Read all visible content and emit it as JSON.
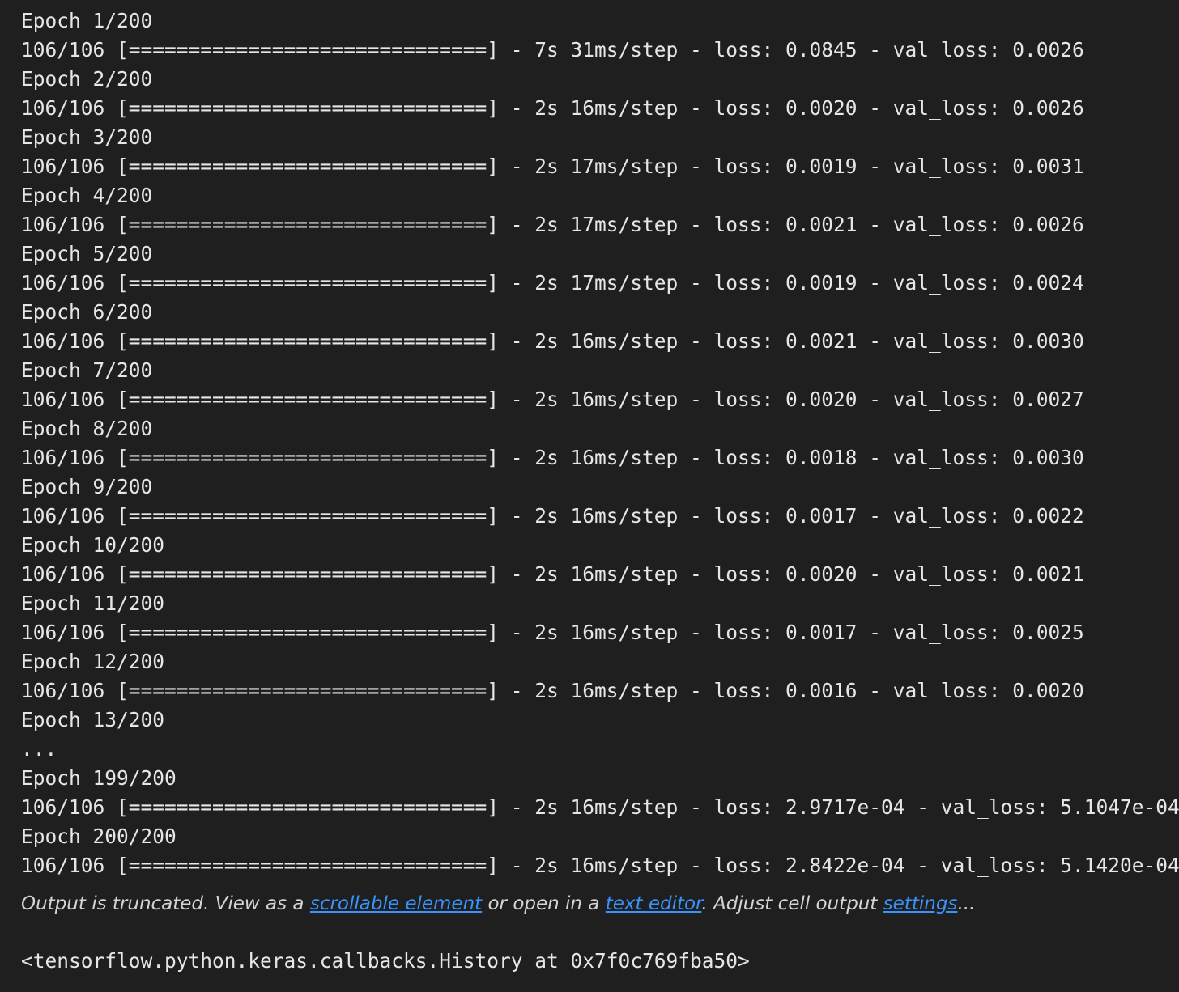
{
  "output": {
    "lines": [
      "Epoch 1/200",
      "106/106 [==============================] - 7s 31ms/step - loss: 0.0845 - val_loss: 0.0026",
      "Epoch 2/200",
      "106/106 [==============================] - 2s 16ms/step - loss: 0.0020 - val_loss: 0.0026",
      "Epoch 3/200",
      "106/106 [==============================] - 2s 17ms/step - loss: 0.0019 - val_loss: 0.0031",
      "Epoch 4/200",
      "106/106 [==============================] - 2s 17ms/step - loss: 0.0021 - val_loss: 0.0026",
      "Epoch 5/200",
      "106/106 [==============================] - 2s 17ms/step - loss: 0.0019 - val_loss: 0.0024",
      "Epoch 6/200",
      "106/106 [==============================] - 2s 16ms/step - loss: 0.0021 - val_loss: 0.0030",
      "Epoch 7/200",
      "106/106 [==============================] - 2s 16ms/step - loss: 0.0020 - val_loss: 0.0027",
      "Epoch 8/200",
      "106/106 [==============================] - 2s 16ms/step - loss: 0.0018 - val_loss: 0.0030",
      "Epoch 9/200",
      "106/106 [==============================] - 2s 16ms/step - loss: 0.0017 - val_loss: 0.0022",
      "Epoch 10/200",
      "106/106 [==============================] - 2s 16ms/step - loss: 0.0020 - val_loss: 0.0021",
      "Epoch 11/200",
      "106/106 [==============================] - 2s 16ms/step - loss: 0.0017 - val_loss: 0.0025",
      "Epoch 12/200",
      "106/106 [==============================] - 2s 16ms/step - loss: 0.0016 - val_loss: 0.0020",
      "Epoch 13/200",
      "...",
      "Epoch 199/200",
      "106/106 [==============================] - 2s 16ms/step - loss: 2.9717e-04 - val_loss: 5.1047e-04",
      "Epoch 200/200",
      "106/106 [==============================] - 2s 16ms/step - loss: 2.8422e-04 - val_loss: 5.1420e-04"
    ],
    "truncation": {
      "text_1": "Output is truncated. View as a ",
      "link_scrollable": "scrollable element",
      "text_2": " or open in a ",
      "link_editor": "text editor",
      "text_3": ". Adjust cell output ",
      "link_settings": "settings",
      "text_4": "..."
    },
    "result": "<tensorflow.python.keras.callbacks.History at 0x7f0c769fba50>"
  },
  "colors": {
    "background": "#1f1f1f",
    "text": "#e6e6e6",
    "link": "#3794ff"
  }
}
